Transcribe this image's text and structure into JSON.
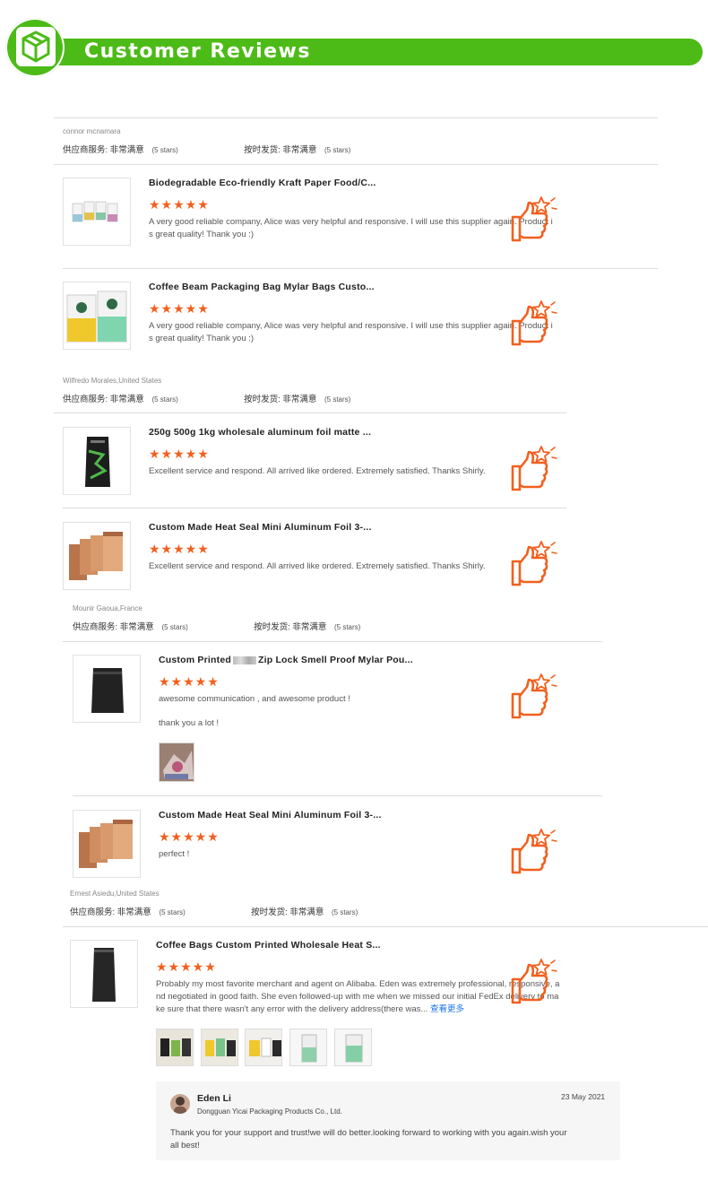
{
  "header": {
    "title": "Customer Reviews",
    "logo_icon": "cube-box-icon"
  },
  "colors": {
    "brand_green": "#4cbb17",
    "star_orange": "#f2601e",
    "link_blue": "#1b73e8"
  },
  "rating_labels": {
    "supplier_service": "供应商服务:",
    "on_time": "按时发货:",
    "very_satisfied": "非常满意",
    "five_stars": "(5 stars)"
  },
  "stars_text": "★★★★★",
  "reviewers": [
    {
      "name": "connor mcnamara"
    },
    {
      "name": "Wilfredo Morales,United States"
    },
    {
      "name": "Mounir Gaoua,France"
    },
    {
      "name": "Ernest Asiedu,United States"
    }
  ],
  "items": [
    {
      "title": "Biodegradable Eco-friendly Kraft Paper Food/C...",
      "rating": 5,
      "review_1": "A very good reliable company, Alice was very helpful and responsive. I will use this supplier again. Product i",
      "review_2": "s great quality! Thank you :)"
    },
    {
      "title": "Coffee Beam Packaging Bag Mylar Bags Custo...",
      "rating": 5,
      "review_1": "A very good reliable company, Alice was very helpful and responsive. I will use this supplier again. Product i",
      "review_2": "s great quality! Thank you :)"
    },
    {
      "title": "250g 500g 1kg wholesale aluminum foil matte ...",
      "rating": 5,
      "review_1": "Excellent service and respond. All arrived like ordered. Extremely satisfied. Thanks Shirly."
    },
    {
      "title": "Custom Made Heat Seal Mini Aluminum Foil 3-...",
      "rating": 5,
      "review_1": "Excellent service and respond. All arrived like ordered. Extremely satisfied. Thanks Shirly."
    },
    {
      "title_a": "Custom Printed",
      "title_b": "Zip Lock Smell Proof Mylar Pou...",
      "rating": 5,
      "review_1": "awesome communication , and awesome product !",
      "review_2": "thank you a lot !"
    },
    {
      "title": "Custom Made Heat Seal Mini Aluminum Foil 3-...",
      "rating": 5,
      "review_1": "perfect !"
    },
    {
      "title": "Coffee Bags Custom Printed Wholesale Heat S...",
      "rating": 5,
      "review_1": "Probably my most favorite merchant and agent on Alibaba.  Eden was extremely professional, responsive, a",
      "review_2": "nd negotiated in good faith. She even followed-up with me when we missed our initial FedEx delivery to ma",
      "review_3": "ke sure that there wasn't any error with the delivery address(there was...",
      "more": "查看更多"
    }
  ],
  "reply": {
    "name": "Eden Li",
    "company": "Dongguan Yicai Packaging Products Co., Ltd.",
    "date": "23 May 2021",
    "text_1": "Thank you for your support and trust!we will do better.looking forward to working with you again.wish your",
    "text_2": "all best!"
  }
}
